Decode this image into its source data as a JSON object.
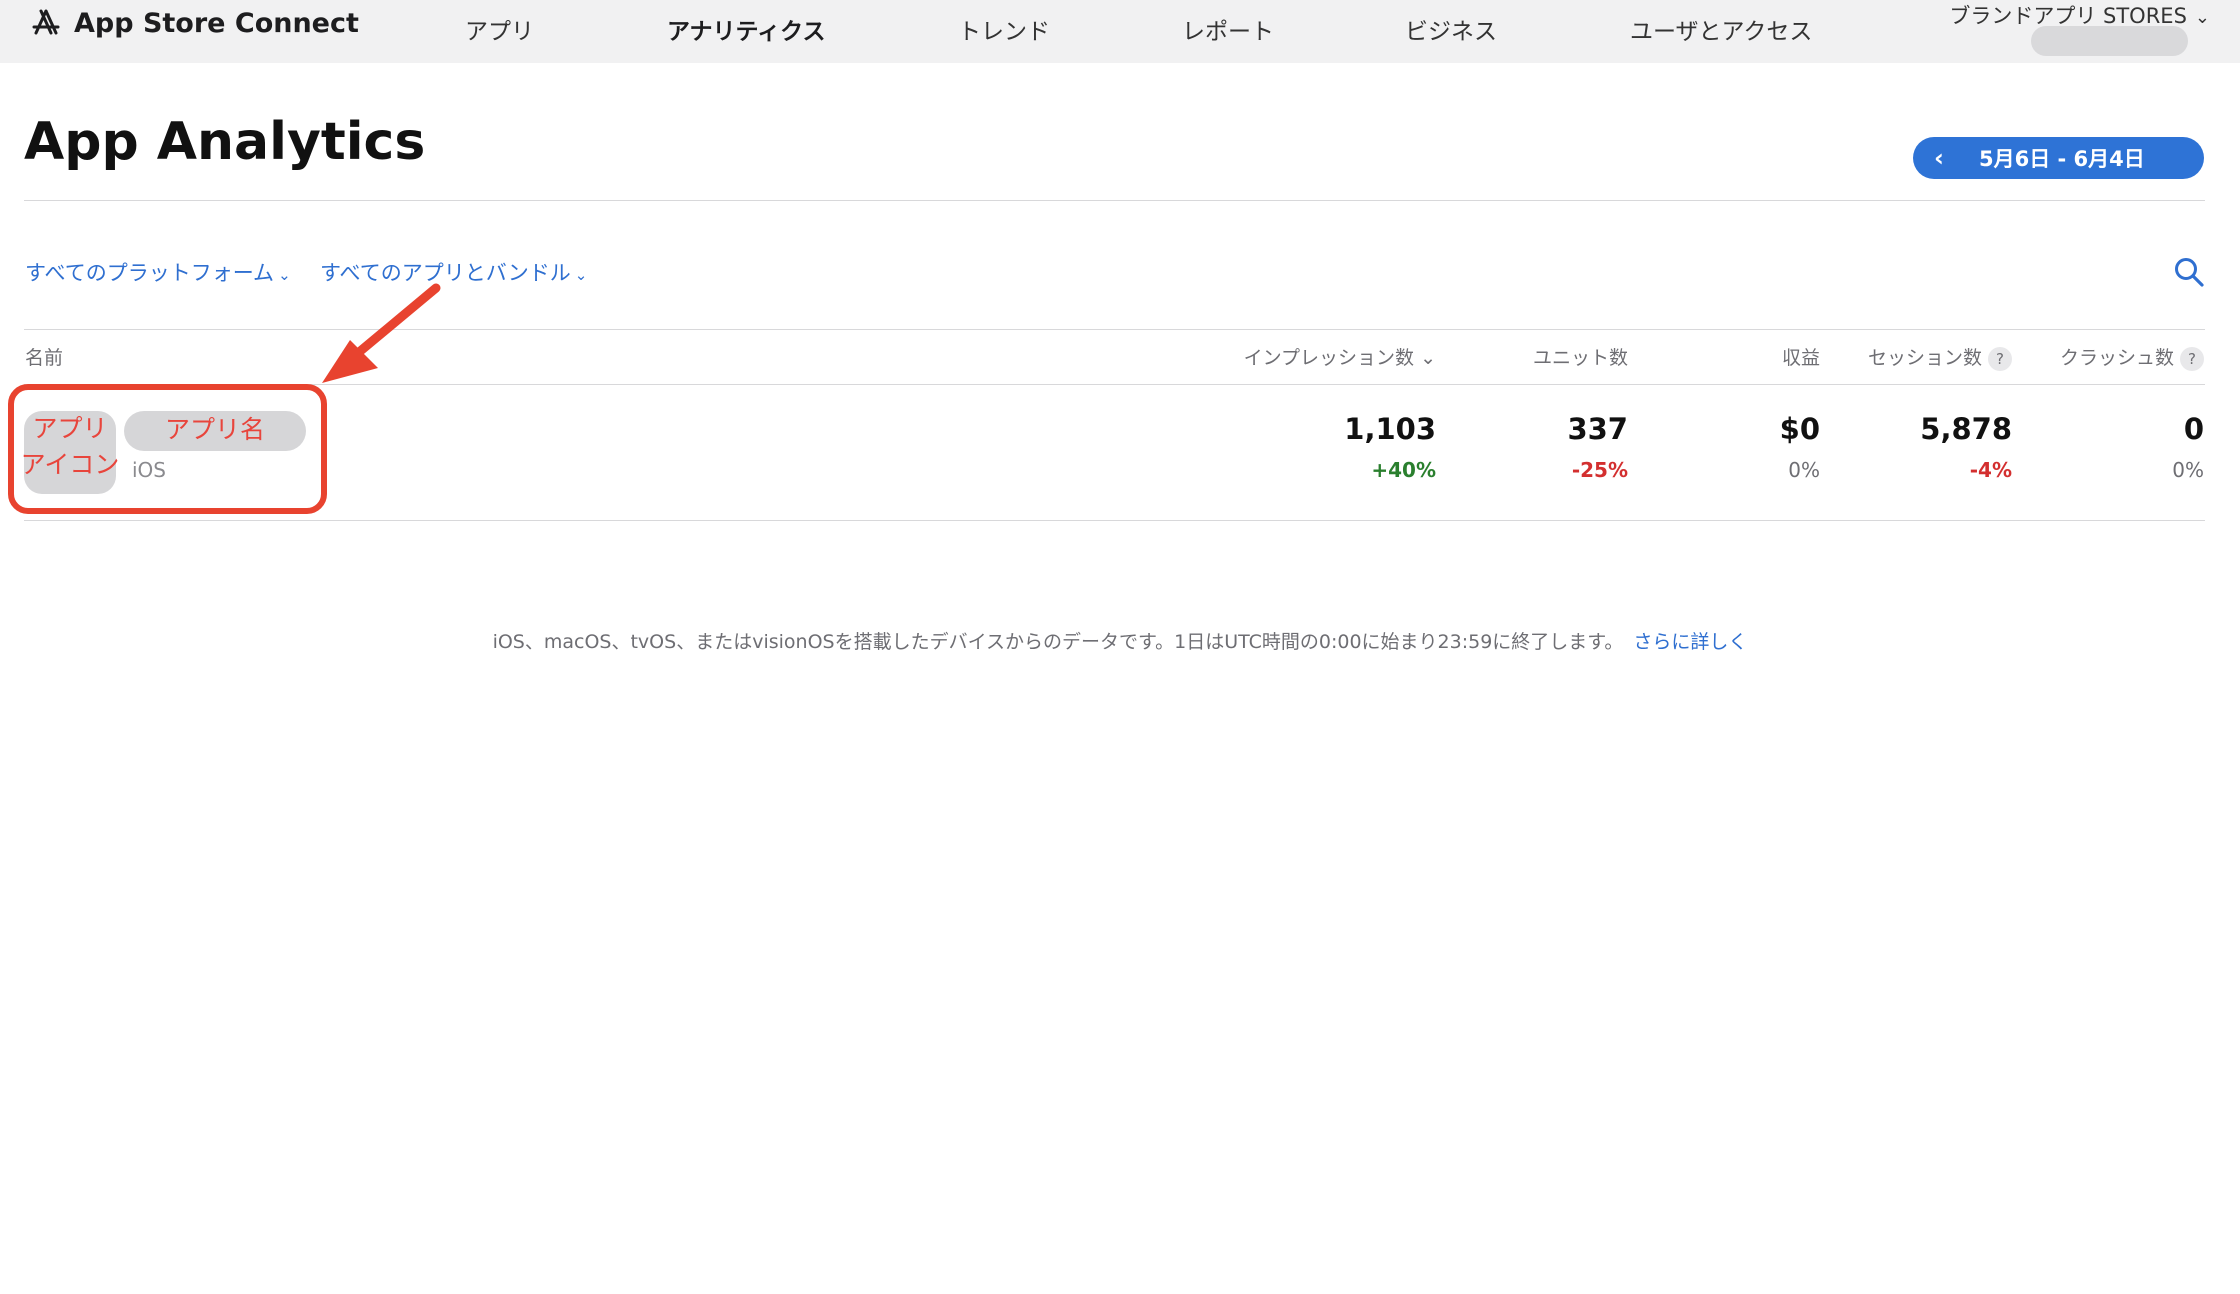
{
  "header": {
    "app_title": "App Store Connect",
    "nav": [
      {
        "label": "アプリ",
        "active": false
      },
      {
        "label": "アナリティクス",
        "active": true
      },
      {
        "label": "トレンド",
        "active": false
      },
      {
        "label": "レポート",
        "active": false
      },
      {
        "label": "ビジネス",
        "active": false
      },
      {
        "label": "ユーザとアクセス",
        "active": false
      }
    ],
    "account_name": "ブランドアプリ STORES"
  },
  "page": {
    "title": "App Analytics",
    "date_range": "5月6日 - 6月4日"
  },
  "filters": {
    "platform": "すべてのプラットフォーム",
    "apps": "すべてのアプリとバンドル"
  },
  "table": {
    "columns": {
      "name": "名前",
      "impressions": "インプレッション数",
      "units": "ユニット数",
      "revenue": "収益",
      "sessions": "セッション数",
      "crashes": "クラッシュ数"
    },
    "help_mark": "?",
    "rows": [
      {
        "icon_label_1": "アプリ",
        "icon_label_2": "アイコン",
        "name": "アプリ名",
        "platform": "iOS",
        "impressions": "1,103",
        "impressions_delta": "+40%",
        "units": "337",
        "units_delta": "-25%",
        "revenue": "$0",
        "revenue_delta": "0%",
        "sessions": "5,878",
        "sessions_delta": "-4%",
        "crashes": "0",
        "crashes_delta": "0%"
      }
    ]
  },
  "footer": {
    "note": "iOS、macOS、tvOS、またはvisionOSを搭載したデバイスからのデータです。1日はUTC時間の0:00に始まり23:59に終了します。",
    "link": "さらに詳しく"
  },
  "colors": {
    "accent": "#2e73d6",
    "positive": "#2a7f2e",
    "negative": "#d32f2f",
    "annotation": "#e8432f"
  }
}
